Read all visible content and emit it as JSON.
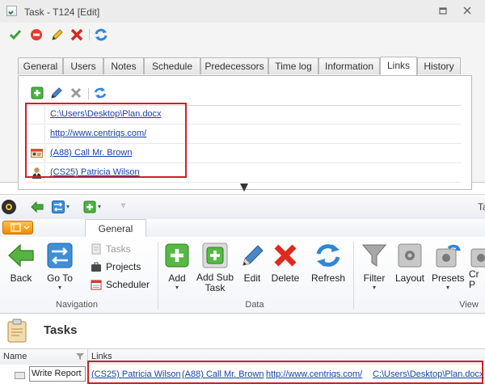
{
  "task_window": {
    "title": "Task - T124 [Edit]",
    "toolbar_icons": [
      "check-icon",
      "cancel-icon",
      "edit-icon",
      "delete-icon",
      "refresh-icon"
    ],
    "tabs": [
      "General",
      "Users",
      "Notes",
      "Schedule",
      "Predecessors",
      "Time log",
      "Information",
      "Links",
      "History"
    ],
    "active_tab": "Links",
    "links_toolbar_icons": [
      "add-icon",
      "edit-icon",
      "delete-icon",
      "refresh-icon"
    ],
    "links": [
      {
        "text": "C:\\Users\\Desktop\\Plan.docx",
        "icon": "none"
      },
      {
        "text": "http://www.centriqs.com/",
        "icon": "none"
      },
      {
        "text": "(A88) Call Mr. Brown",
        "icon": "contact-card-icon"
      },
      {
        "text": "(CS25) Patricia Wilson",
        "icon": "person-icon"
      }
    ]
  },
  "main_window": {
    "title_fragment": "Ta",
    "ribbon_tab": "General",
    "ribbon": {
      "navigation": {
        "group_label": "Navigation",
        "back": "Back",
        "goto": "Go To",
        "small_items": [
          "Tasks",
          "Projects",
          "Scheduler"
        ]
      },
      "data": {
        "group_label": "Data",
        "buttons": [
          "Add",
          "Add Sub Task",
          "Edit",
          "Delete",
          "Refresh"
        ]
      },
      "view": {
        "group_label": "View",
        "buttons": [
          "Filter",
          "Layout",
          "Presets",
          "Cr P"
        ]
      }
    },
    "page_title": "Tasks",
    "grid": {
      "columns": [
        "Name",
        "Links"
      ],
      "row_name": "Write Report",
      "row_links": [
        "(CS25) Patricia Wilson",
        "(A88) Call Mr. Brown",
        "http://www.centriqs.com/",
        "C:\\Users\\Desktop\\Plan.docx"
      ]
    }
  },
  "colors": {
    "highlight_border": "#d21d2a",
    "link": "#1a3fa8",
    "accent_orange": "#f08a00"
  }
}
